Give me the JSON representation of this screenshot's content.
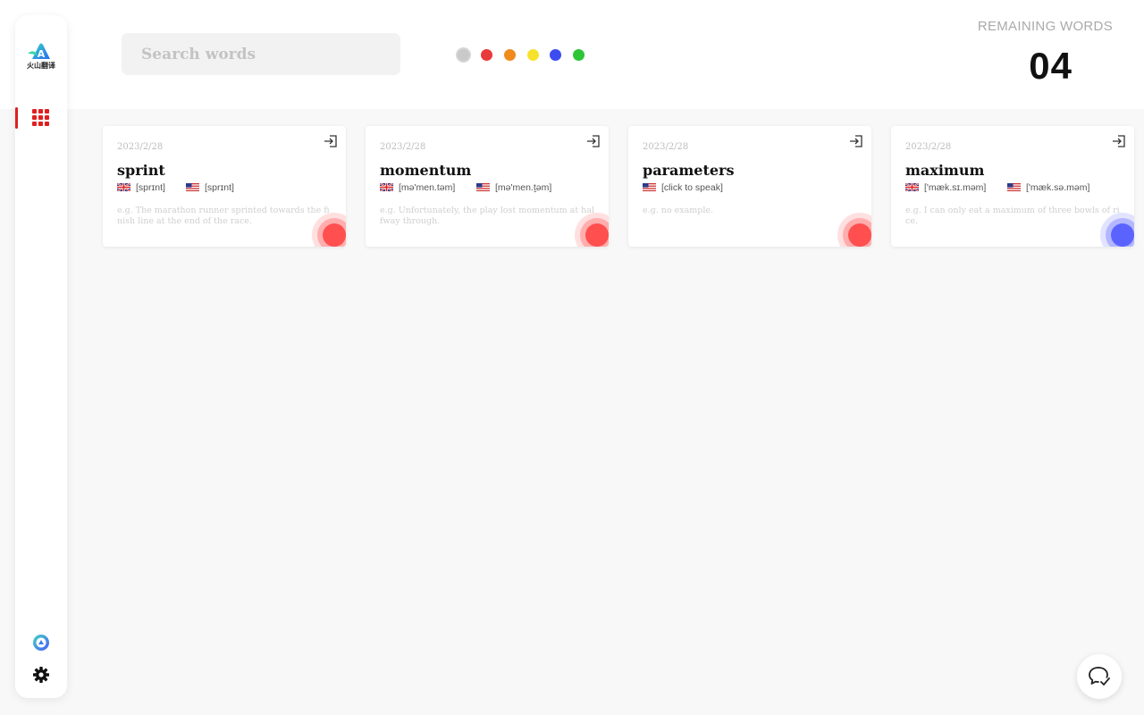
{
  "app": {
    "logo_text": "火山翻译"
  },
  "search": {
    "placeholder": "Search words"
  },
  "color_filters": [
    {
      "name": "all",
      "color": "#c9c9c9",
      "selected": true
    },
    {
      "name": "red",
      "color": "#e83a3a",
      "selected": false
    },
    {
      "name": "orange",
      "color": "#f08a1c",
      "selected": false
    },
    {
      "name": "yellow",
      "color": "#f6e22c",
      "selected": false
    },
    {
      "name": "blue",
      "color": "#3d4cf0",
      "selected": false
    },
    {
      "name": "green",
      "color": "#2dc636",
      "selected": false
    }
  ],
  "remaining": {
    "label": "REMAINING WORDS",
    "count": "04"
  },
  "cards": [
    {
      "date": "2023/2/28",
      "word": "sprint",
      "uk": "[sprɪnt]",
      "us": "[sprɪnt]",
      "example": "e.g. The marathon runner sprinted towards the finish line at the end of the race.",
      "color": "#ff4f4f"
    },
    {
      "date": "2023/2/28",
      "word": "momentum",
      "uk": "[mə'men.təm]",
      "us": "[mə'men.t̬əm]",
      "example": "e.g. Unfortunately, the play lost momentum at halfway through.",
      "color": "#ff4f4f"
    },
    {
      "date": "2023/2/28",
      "word": "parameters",
      "us": "[click to speak]",
      "example": "e.g. no example.",
      "color": "#ff4f4f"
    },
    {
      "date": "2023/2/28",
      "word": "maximum",
      "uk": "['mæk.sɪ.məm]",
      "us": "['mæk.sə.məm]",
      "example": "e.g. I can only eat a maximum of three bowls of rice.",
      "color": "#5b63ff"
    }
  ],
  "icons": {
    "nav_active": "apps-grid-icon",
    "sidebar_bottom": [
      "volcano-logo-icon",
      "gear-icon"
    ],
    "card_action": "open-in-icon",
    "floating": "chat-feedback-icon"
  },
  "accent": "#e02020"
}
